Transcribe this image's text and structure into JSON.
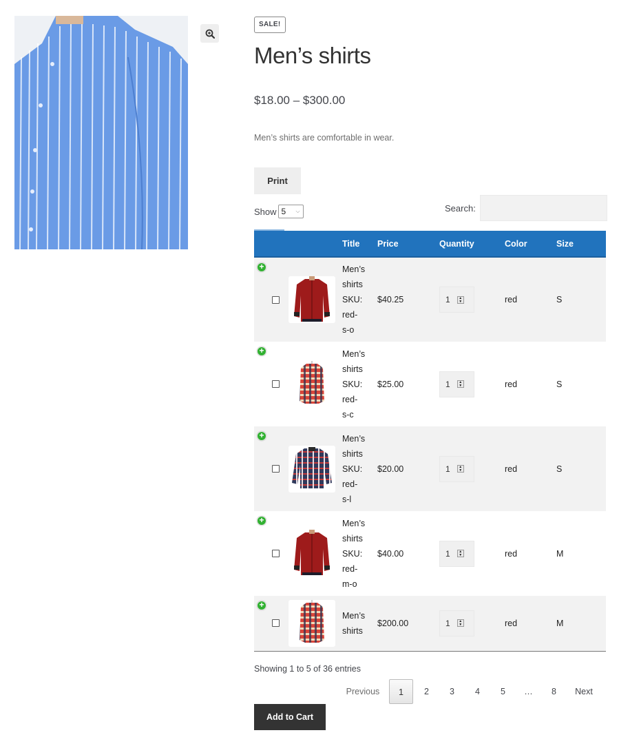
{
  "gallery": {
    "main_image_alt": "Blue striped men's shirt",
    "zoom_icon": "zoom-in-icon"
  },
  "product": {
    "badge": "SALE!",
    "title": "Men’s shirts",
    "price_range": "$18.00 – $300.00",
    "description": "Men’s shirts are comfortable in wear."
  },
  "toolbar": {
    "print_label": "Print",
    "show_label": "Show",
    "show_value": "5",
    "search_label": "Search:",
    "search_value": "",
    "search_placeholder": ""
  },
  "table": {
    "columns": [
      "",
      "",
      "Title",
      "Price",
      "Quantity",
      "Color",
      "Size"
    ],
    "rows": [
      {
        "title_lines": [
          "Men’s",
          "shirts",
          "SKU:",
          "red-",
          "s-o"
        ],
        "price": "$40.25",
        "quantity": "1",
        "color": "red",
        "size": "S",
        "thumb": "red-shirt"
      },
      {
        "title_lines": [
          "Men’s",
          "shirts",
          "SKU:",
          "red-",
          "s-c"
        ],
        "price": "$25.00",
        "quantity": "1",
        "color": "red",
        "size": "S",
        "thumb": "plaid-red-shirt"
      },
      {
        "title_lines": [
          "Men’s",
          "shirts",
          "SKU:",
          "red-",
          "s-l"
        ],
        "price": "$20.00",
        "quantity": "1",
        "color": "red",
        "size": "S",
        "thumb": "plaid-navy-shirt"
      },
      {
        "title_lines": [
          "Men’s",
          "shirts",
          "SKU:",
          "red-",
          "m-o"
        ],
        "price": "$40.00",
        "quantity": "1",
        "color": "red",
        "size": "M",
        "thumb": "red-shirt"
      },
      {
        "title_lines": [
          "Men’s",
          "shirts"
        ],
        "price": "$200.00",
        "quantity": "1",
        "color": "red",
        "size": "M",
        "thumb": "plaid-red-shirt"
      }
    ]
  },
  "footer": {
    "info": "Showing 1 to 5 of 36 entries",
    "pagination": {
      "previous": "Previous",
      "pages": [
        "1",
        "2",
        "3",
        "4",
        "5",
        "…",
        "8"
      ],
      "current": "1",
      "next": "Next"
    },
    "add_to_cart": "Add to Cart"
  },
  "colors": {
    "header_blue": "#2173bd",
    "add_green": "#31b131",
    "button_dark": "#333333"
  }
}
